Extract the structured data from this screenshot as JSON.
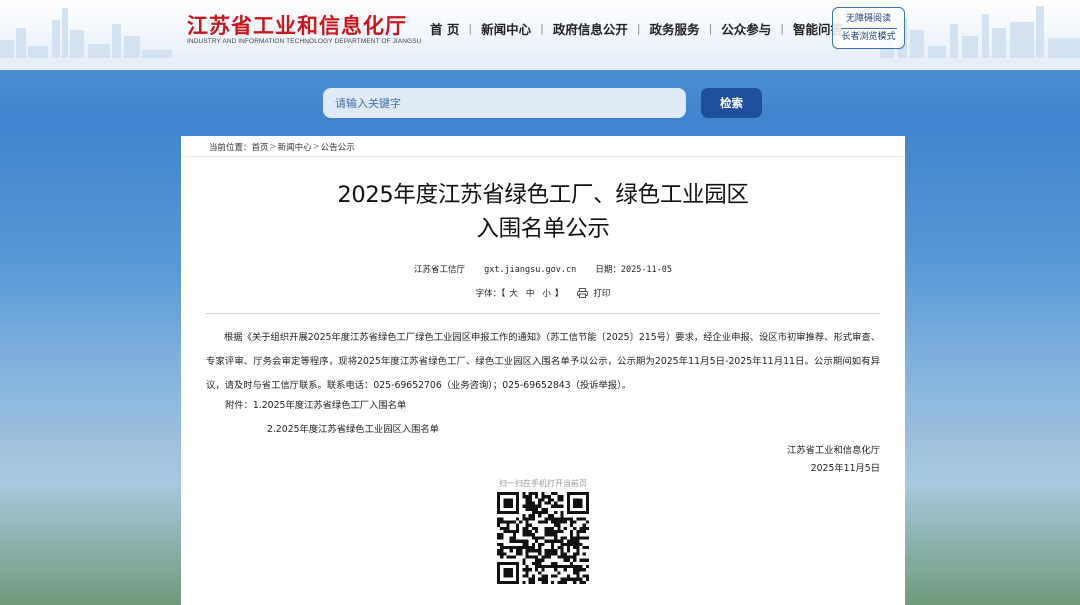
{
  "site": {
    "logo_cn": "江苏省工业和信息化厅",
    "logo_en": "INDUSTRY AND INFORMATION TECHNOLOGY DEPARTMENT OF JIANGSU"
  },
  "nav": {
    "items": [
      {
        "label": "首 页"
      },
      {
        "label": "新闻中心"
      },
      {
        "label": "政府信息公开"
      },
      {
        "label": "政务服务"
      },
      {
        "label": "公众参与"
      },
      {
        "label": "智能问答"
      }
    ],
    "separator": "|"
  },
  "modes": {
    "accessible": "无障碍阅读",
    "elder": "长者浏览模式"
  },
  "search": {
    "placeholder": "请输入关键字",
    "button": "检索"
  },
  "breadcrumb": {
    "prefix": "当前位置：",
    "items": [
      "首页",
      "新闻中心",
      "公告公示"
    ],
    "sep": ">"
  },
  "article": {
    "title_line1": "2025年度江苏省绿色工厂、绿色工业园区",
    "title_line2": "入围名单公示",
    "source": "江苏省工信厅",
    "site": "gxt.jiangsu.gov.cn",
    "date_label": "日期：2025-11-05",
    "font_label": "字体：【",
    "font_large": "大",
    "font_medium": "中",
    "font_small": "小",
    "font_close": "】",
    "print": "打印",
    "body": "根据《关于组织开展2025年度江苏省绿色工厂绿色工业园区申报工作的通知》（苏工信节能〔2025〕215号）要求，经企业申报、设区市初审推荐、形式审查、专家评审、厅务会审定等程序，现将2025年度江苏省绿色工厂、绿色工业园区入围名单予以公示，公示期为2025年11月5日-2025年11月11日。公示期间如有异议，请及时与省工信厅联系。联系电话：025-69652706（业务咨询）；025-69652843（投诉举报）。",
    "attachment_1": "附件：1.2025年度江苏省绿色工厂入围名单",
    "attachment_2": "2.2025年度江苏省绿色工业园区入围名单",
    "sign_org": "江苏省工业和信息化厅",
    "sign_date": "2025年11月5日",
    "qr_label": "扫一扫在手机打开当前页"
  },
  "colors": {
    "brand_red": "#c8161d",
    "nav_blue": "#1f4f9c"
  }
}
